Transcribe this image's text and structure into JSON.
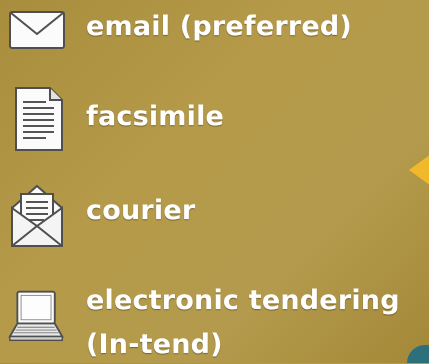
{
  "methods": [
    {
      "label": "email (preferred)",
      "icon": "envelope-icon"
    },
    {
      "label": "facsimile",
      "icon": "document-icon"
    },
    {
      "label": "courier",
      "icon": "open-envelope-icon"
    },
    {
      "label_line1": "electronic tendering",
      "label_line2": "(In-tend)",
      "icon": "laptop-icon"
    }
  ],
  "colors": {
    "background": "#b49a4c",
    "text": "#ffffff",
    "accent": "#f1b92a",
    "corner": "#2e6f7c"
  }
}
